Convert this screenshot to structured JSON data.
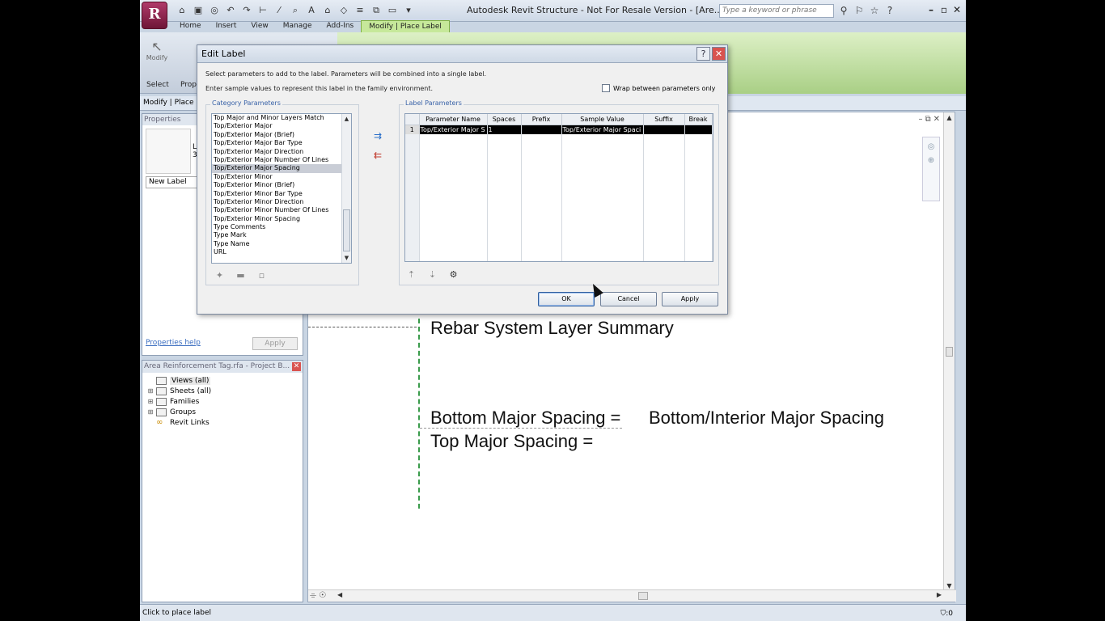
{
  "titlebar": {
    "app_logo": "R",
    "title": "Autodesk Revit Structure - Not For Resale Version - [Are...",
    "search_placeholder": "Type a keyword or phrase"
  },
  "ribbon": {
    "tabs": [
      "Home",
      "Insert",
      "View",
      "Manage",
      "Add-Ins",
      "Modify | Place Label"
    ],
    "active_tab": "Modify | Place Label",
    "modify_label": "Modify",
    "select_label": "Select",
    "prop_label": "Prop"
  },
  "context_bar": "Modify | Place L",
  "properties": {
    "title": "Properties",
    "type_fragment": "L\n3",
    "type_selector": "New Label",
    "help_link": "Properties help",
    "apply": "Apply"
  },
  "browser": {
    "title": "Area Reinforcement Tag.rfa - Project B...",
    "items": [
      {
        "label": "Views (all)",
        "expand": "",
        "icon": "views-icon"
      },
      {
        "label": "Sheets (all)",
        "expand": "⊞",
        "icon": "sheets-icon"
      },
      {
        "label": "Families",
        "expand": "⊞",
        "icon": "families-icon"
      },
      {
        "label": "Groups",
        "expand": "⊞",
        "icon": "groups-icon"
      },
      {
        "label": "Revit Links",
        "expand": "",
        "icon": "link-icon"
      }
    ]
  },
  "drawing": {
    "heading": "Rebar System Layer Summary",
    "line1_label": "Bottom Major Spacing =",
    "line1_value": "Bottom/Interior Major Spacing",
    "line2_label": "Top Major Spacing ="
  },
  "status": {
    "text": "Click to place label",
    "filter": ":0"
  },
  "dialog": {
    "title": "Edit Label",
    "help": "?",
    "instruction1": "Select parameters to add to the label.  Parameters will be combined into a single label.",
    "instruction2": "Enter sample values to represent this label in the family environment.",
    "wrap_label": "Wrap between parameters only",
    "category_group": "Category Parameters",
    "label_group": "Label Parameters",
    "category_items": [
      "Top Major and Minor Layers Match",
      "Top/Exterior Major",
      "Top/Exterior Major (Brief)",
      "Top/Exterior Major Bar Type",
      "Top/Exterior Major Direction",
      "Top/Exterior Major Number Of Lines",
      "Top/Exterior Major Spacing",
      "Top/Exterior Minor",
      "Top/Exterior Minor (Brief)",
      "Top/Exterior Minor Bar Type",
      "Top/Exterior Minor Direction",
      "Top/Exterior Minor Number Of Lines",
      "Top/Exterior Minor Spacing",
      "Type Comments",
      "Type Mark",
      "Type Name",
      "URL"
    ],
    "selected_index": 6,
    "columns": [
      "",
      "Parameter Name",
      "Spaces",
      "Prefix",
      "Sample Value",
      "Suffix",
      "Break"
    ],
    "rows": [
      {
        "num": "1",
        "name": "Top/Exterior Major S",
        "spaces": "1",
        "prefix": "",
        "sample": "Top/Exterior Major Spaci",
        "suffix": "",
        "brk": ""
      }
    ],
    "ok": "OK",
    "cancel": "Cancel",
    "apply": "Apply"
  }
}
